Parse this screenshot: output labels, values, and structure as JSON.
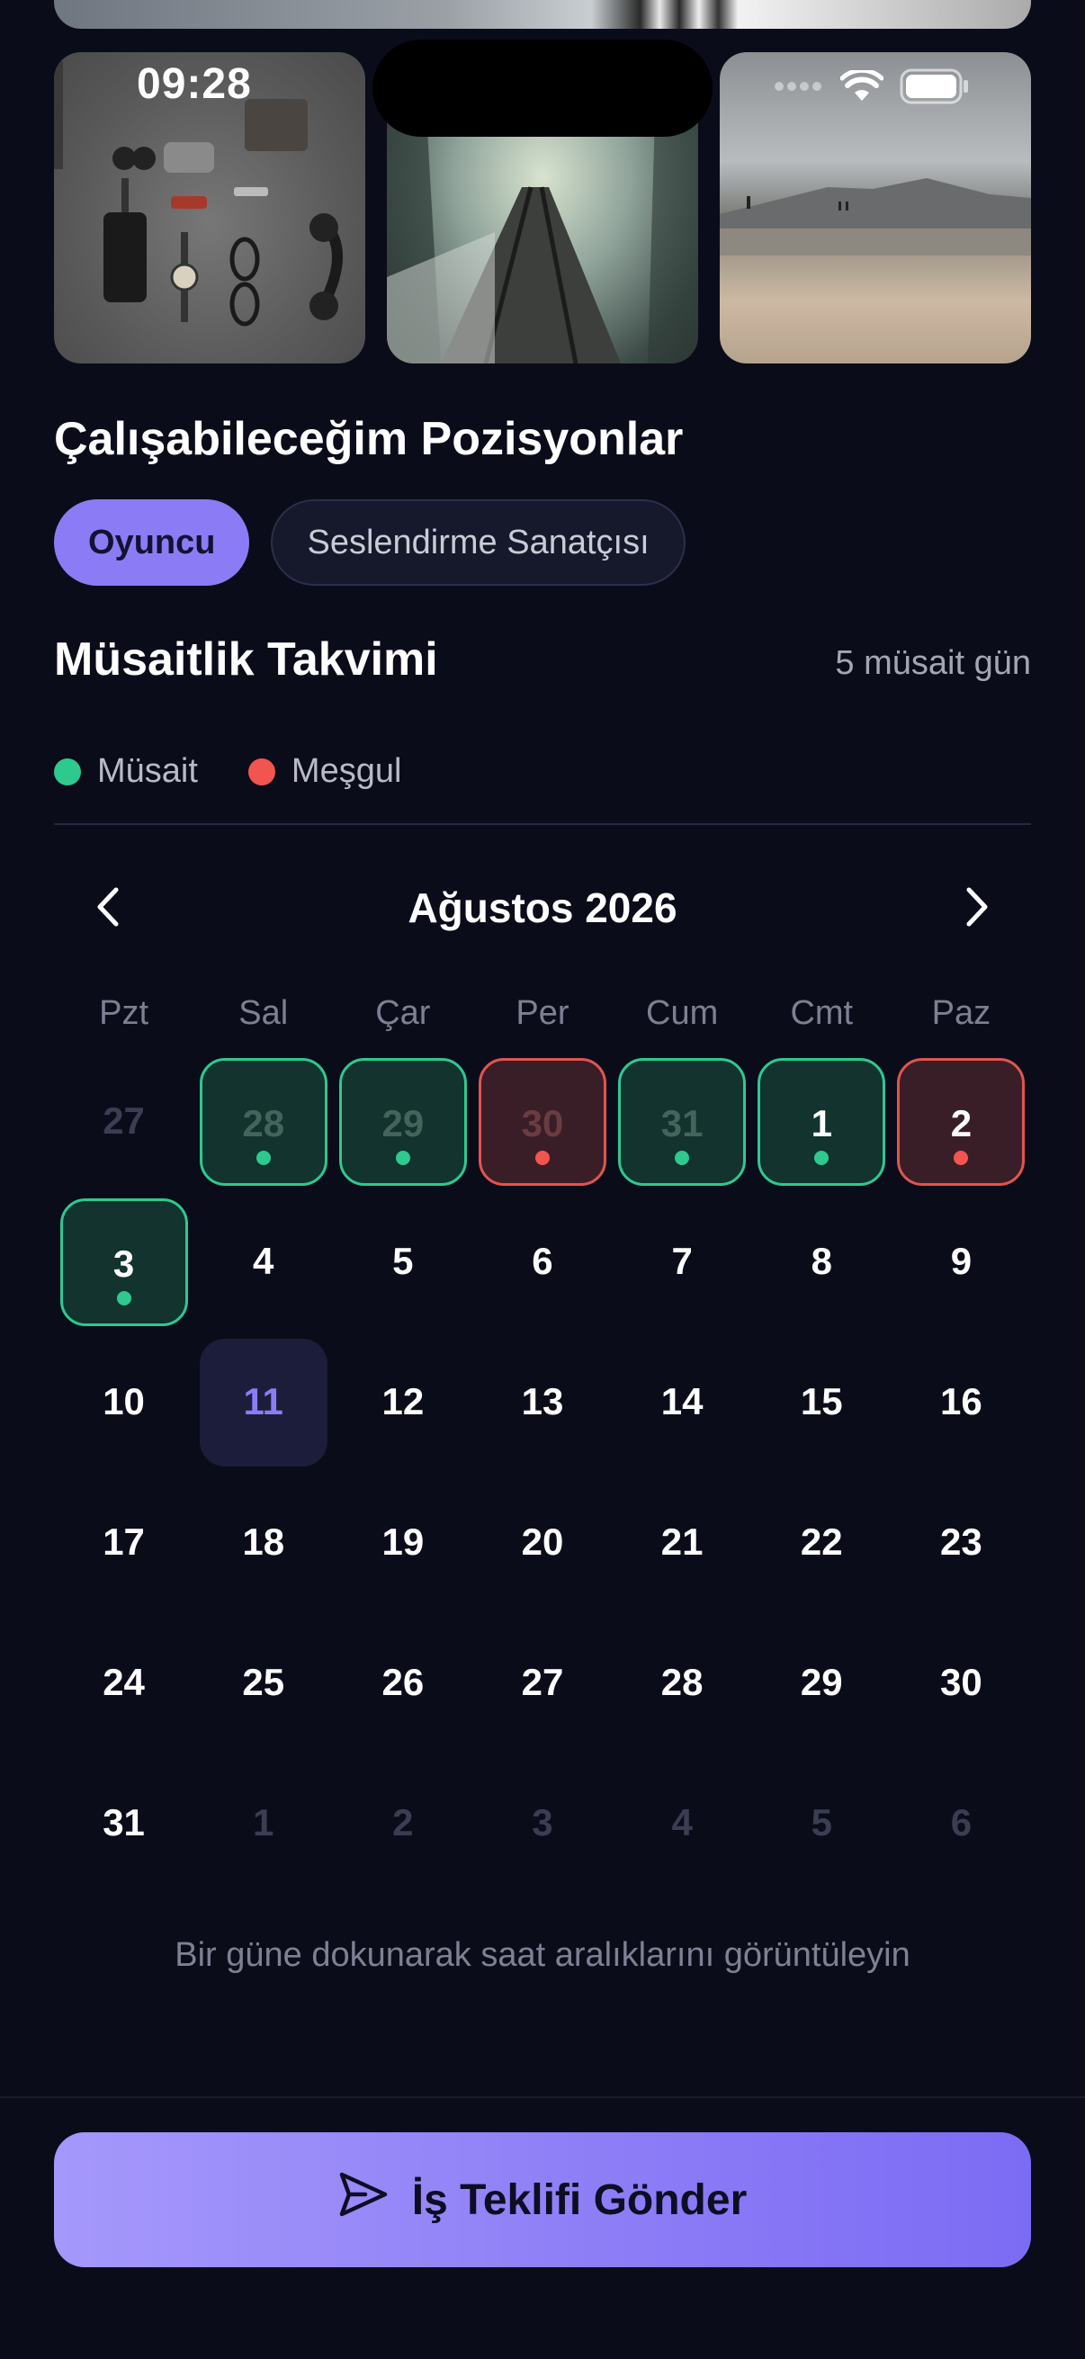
{
  "status_bar": {
    "time": "09:28"
  },
  "gallery": {
    "photos": [
      {
        "subject": "flat lay of sunglasses, bow tie, phone, watch, glasses and headphones"
      },
      {
        "subject": "foggy forest railway tracks"
      },
      {
        "subject": "overcast beach with mountains"
      }
    ]
  },
  "positions": {
    "title": "Çalışabileceğim Pozisyonlar",
    "chips": [
      {
        "label": "Oyuncu",
        "active": true
      },
      {
        "label": "Seslendirme Sanatçısı",
        "active": false
      }
    ]
  },
  "calendar": {
    "title": "Müsaitlik Takvimi",
    "available_count": "5 müsait gün",
    "legend": {
      "available": "Müsait",
      "busy": "Meşgul"
    },
    "month": "Ağustos 2026",
    "weekdays": [
      "Pzt",
      "Sal",
      "Çar",
      "Per",
      "Cum",
      "Cmt",
      "Paz"
    ],
    "days": [
      {
        "n": "27",
        "other": true,
        "state": ""
      },
      {
        "n": "28",
        "other": true,
        "state": "available"
      },
      {
        "n": "29",
        "other": true,
        "state": "available"
      },
      {
        "n": "30",
        "other": true,
        "state": "busy"
      },
      {
        "n": "31",
        "other": true,
        "state": "available"
      },
      {
        "n": "1",
        "other": false,
        "state": "available"
      },
      {
        "n": "2",
        "other": false,
        "state": "busy"
      },
      {
        "n": "3",
        "other": false,
        "state": "available"
      },
      {
        "n": "4",
        "other": false,
        "state": ""
      },
      {
        "n": "5",
        "other": false,
        "state": ""
      },
      {
        "n": "6",
        "other": false,
        "state": ""
      },
      {
        "n": "7",
        "other": false,
        "state": ""
      },
      {
        "n": "8",
        "other": false,
        "state": ""
      },
      {
        "n": "9",
        "other": false,
        "state": ""
      },
      {
        "n": "10",
        "other": false,
        "state": ""
      },
      {
        "n": "11",
        "other": false,
        "state": "today"
      },
      {
        "n": "12",
        "other": false,
        "state": ""
      },
      {
        "n": "13",
        "other": false,
        "state": ""
      },
      {
        "n": "14",
        "other": false,
        "state": ""
      },
      {
        "n": "15",
        "other": false,
        "state": ""
      },
      {
        "n": "16",
        "other": false,
        "state": ""
      },
      {
        "n": "17",
        "other": false,
        "state": ""
      },
      {
        "n": "18",
        "other": false,
        "state": ""
      },
      {
        "n": "19",
        "other": false,
        "state": ""
      },
      {
        "n": "20",
        "other": false,
        "state": ""
      },
      {
        "n": "21",
        "other": false,
        "state": ""
      },
      {
        "n": "22",
        "other": false,
        "state": ""
      },
      {
        "n": "23",
        "other": false,
        "state": ""
      },
      {
        "n": "24",
        "other": false,
        "state": ""
      },
      {
        "n": "25",
        "other": false,
        "state": ""
      },
      {
        "n": "26",
        "other": false,
        "state": ""
      },
      {
        "n": "27",
        "other": false,
        "state": ""
      },
      {
        "n": "28",
        "other": false,
        "state": ""
      },
      {
        "n": "29",
        "other": false,
        "state": ""
      },
      {
        "n": "30",
        "other": false,
        "state": ""
      },
      {
        "n": "31",
        "other": false,
        "state": ""
      },
      {
        "n": "1",
        "other": true,
        "state": ""
      },
      {
        "n": "2",
        "other": true,
        "state": ""
      },
      {
        "n": "3",
        "other": true,
        "state": ""
      },
      {
        "n": "4",
        "other": true,
        "state": ""
      },
      {
        "n": "5",
        "other": true,
        "state": ""
      },
      {
        "n": "6",
        "other": true,
        "state": ""
      }
    ],
    "hint": "Bir güne dokunarak saat aralıklarını görüntüleyin"
  },
  "cta": {
    "label": "İş Teklifi Gönder",
    "icon": "send-icon"
  },
  "colors": {
    "background": "#0b0c1a",
    "accent": "#8b7cf6",
    "available": "#2ec98f",
    "busy": "#f2554f"
  }
}
